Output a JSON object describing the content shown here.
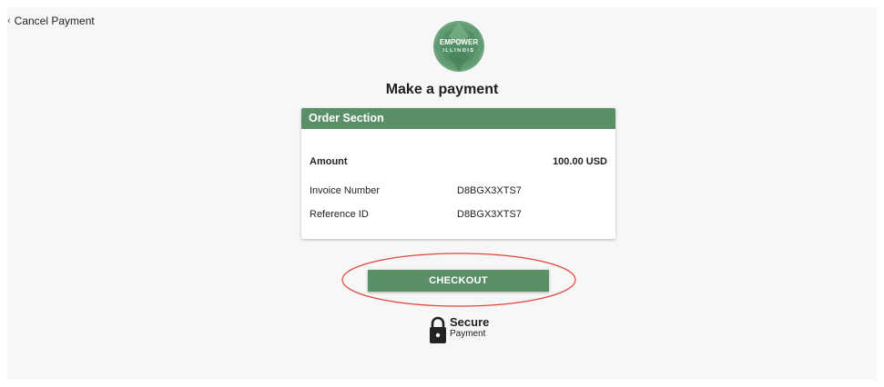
{
  "nav": {
    "cancel_label": "Cancel Payment"
  },
  "logo": {
    "line1": "EMPOWER",
    "line2": "ILLINOIS"
  },
  "page": {
    "title": "Make a payment"
  },
  "order": {
    "header": "Order Section",
    "amount_label": "Amount",
    "amount_value": "100.00 USD",
    "invoice_label": "Invoice Number",
    "invoice_value": "D8BGX3XTS7",
    "reference_label": "Reference ID",
    "reference_value": "D8BGX3XTS7"
  },
  "checkout": {
    "label": "CHECKOUT"
  },
  "secure": {
    "title": "Secure",
    "subtitle": "Payment"
  },
  "colors": {
    "accent": "#5a9067",
    "highlight": "#e0453a",
    "background": "#f7f7f7"
  },
  "icons": {
    "cancel": "chevron-left-icon",
    "secure": "lock-icon"
  }
}
